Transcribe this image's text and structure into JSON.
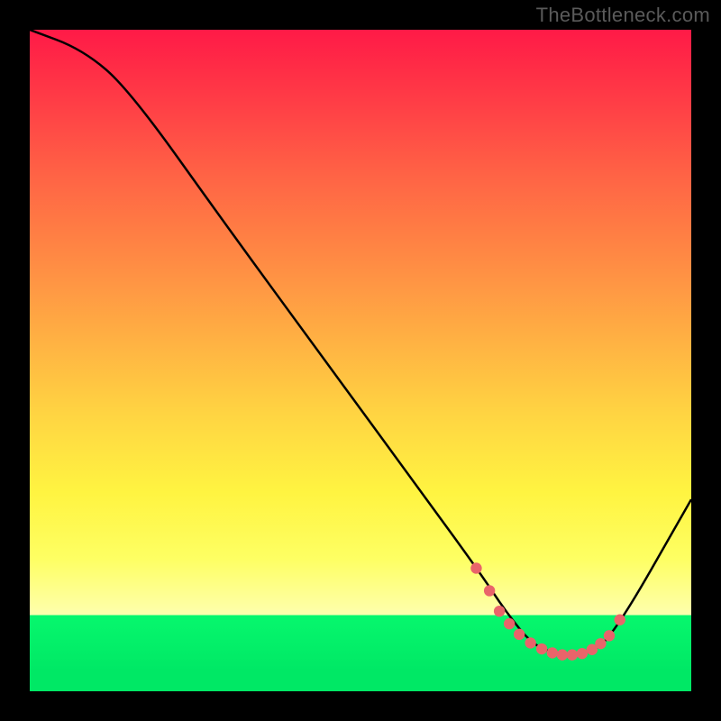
{
  "watermark": "TheBottleneck.com",
  "chart_data": {
    "type": "line",
    "title": "",
    "xlabel": "",
    "ylabel": "",
    "xlim": [
      0,
      100
    ],
    "ylim": [
      0,
      100
    ],
    "series": [
      {
        "name": "curve",
        "x": [
          0,
          8,
          15,
          30,
          45,
          60,
          68,
          72,
          76,
          80,
          84,
          88,
          100
        ],
        "y": [
          100,
          97,
          91,
          70,
          49.5,
          29,
          18,
          12,
          7,
          5.5,
          5.5,
          8,
          29
        ]
      }
    ],
    "markers": {
      "name": "highlighted-points",
      "x": [
        67.5,
        69.5,
        71,
        72.5,
        74,
        75.7,
        77.4,
        79,
        80.5,
        82,
        83.5,
        85,
        86.3,
        87.6,
        89.2
      ],
      "y": [
        18.6,
        15.2,
        12.1,
        10.2,
        8.6,
        7.3,
        6.4,
        5.8,
        5.5,
        5.5,
        5.7,
        6.3,
        7.2,
        8.4,
        10.8
      ]
    },
    "gradient_background": {
      "top_color": "#ff1a47",
      "bottom_color": "#00e865"
    }
  }
}
